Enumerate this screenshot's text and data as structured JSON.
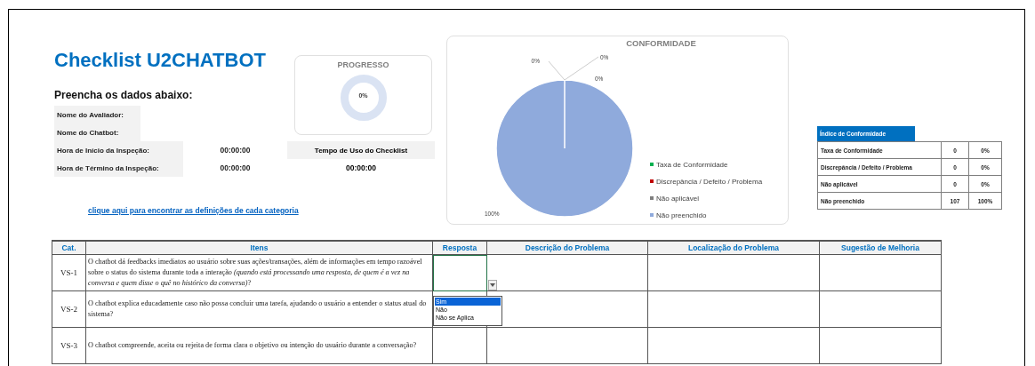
{
  "title": "Checklist U2CHATBOT",
  "form": {
    "heading": "Preencha os dados abaixo:",
    "fields": [
      {
        "label": "Nome do Avaliador:"
      },
      {
        "label": "Nome do Chatbot:"
      },
      {
        "label": "Hora de Início da Inspeção:",
        "value": "00:00:00"
      },
      {
        "label": "Hora de Término da Inspeção:",
        "value": "00:00:00"
      }
    ],
    "usage": {
      "label": "Tempo de Uso do Checklist",
      "value": "00:00:00"
    },
    "link": "clique aqui para encontrar as definições de cada categoria"
  },
  "progress": {
    "title": "PROGRESSO",
    "level": 0,
    "reading": "0%"
  },
  "conformity_chart": {
    "chart_data": {
      "type": "pie",
      "title": "CONFORMIDADE",
      "categories": [
        "Taxa de Conformidade",
        "Discrepância / Defeito / Problema",
        "Não aplicável",
        "Não preenchido"
      ],
      "values": [
        0,
        0,
        0,
        100
      ],
      "colors": [
        "#00b050",
        "#c00000",
        "#7f7f7f",
        "#8faadc"
      ],
      "data_labels": true,
      "value_labels": [
        "0%",
        "0%",
        "0%",
        "100%"
      ]
    }
  },
  "index_table": {
    "title": "Índice de Conformidade",
    "rows": [
      {
        "label": "Taxa de Conformidade",
        "count": "0",
        "percent": "0%"
      },
      {
        "label": "Discrepância / Defeito / Problema",
        "count": "0",
        "percent": "0%"
      },
      {
        "label": "Não aplicável",
        "count": "0",
        "percent": "0%"
      },
      {
        "label": "Não preenchido",
        "count": "107",
        "percent": "100%"
      }
    ]
  },
  "table": {
    "columns": [
      "Cat.",
      "Itens",
      "Resposta",
      "Descrição do Problema",
      "Localização do Problema",
      "Sugestão de Melhoria"
    ],
    "rows": [
      {
        "cat": "VS-1",
        "item": "O chatbot dá feedbacks imediatos ao usuário sobre suas ações/transações, além de informações em tempo razoável sobre o status do sistema durante toda a interação *(quando está processando uma resposta, de quem é a vez na conversa e quem disse o quê no histórico da conversa)*?",
        "focused": true
      },
      {
        "cat": "VS-2",
        "item": "O chatbot explica educadamente caso não possa concluir uma tarefa, ajudando o usuário a entender o status atual do sistema?",
        "focused": false
      },
      {
        "cat": "VS-3",
        "item": "O chatbot compreende, aceita ou rejeita de forma clara o objetivo ou intenção do usuário durante a conversação?",
        "focused": false
      }
    ],
    "dropdown": {
      "options": [
        {
          "label": "Sim",
          "selected": true
        },
        {
          "label": "Não",
          "selected": false
        },
        {
          "label": "Não se Aplica",
          "selected": false
        }
      ]
    }
  }
}
